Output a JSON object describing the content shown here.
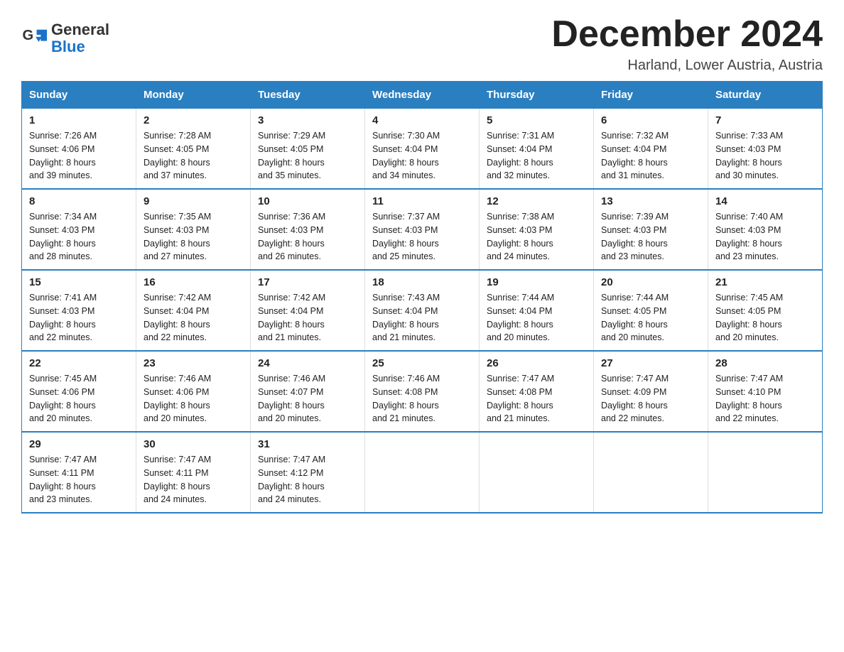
{
  "header": {
    "logo_text_general": "General",
    "logo_text_blue": "Blue",
    "month_title": "December 2024",
    "location": "Harland, Lower Austria, Austria"
  },
  "weekdays": [
    "Sunday",
    "Monday",
    "Tuesday",
    "Wednesday",
    "Thursday",
    "Friday",
    "Saturday"
  ],
  "weeks": [
    [
      {
        "day": "1",
        "sunrise": "7:26 AM",
        "sunset": "4:06 PM",
        "daylight": "8 hours and 39 minutes."
      },
      {
        "day": "2",
        "sunrise": "7:28 AM",
        "sunset": "4:05 PM",
        "daylight": "8 hours and 37 minutes."
      },
      {
        "day": "3",
        "sunrise": "7:29 AM",
        "sunset": "4:05 PM",
        "daylight": "8 hours and 35 minutes."
      },
      {
        "day": "4",
        "sunrise": "7:30 AM",
        "sunset": "4:04 PM",
        "daylight": "8 hours and 34 minutes."
      },
      {
        "day": "5",
        "sunrise": "7:31 AM",
        "sunset": "4:04 PM",
        "daylight": "8 hours and 32 minutes."
      },
      {
        "day": "6",
        "sunrise": "7:32 AM",
        "sunset": "4:04 PM",
        "daylight": "8 hours and 31 minutes."
      },
      {
        "day": "7",
        "sunrise": "7:33 AM",
        "sunset": "4:03 PM",
        "daylight": "8 hours and 30 minutes."
      }
    ],
    [
      {
        "day": "8",
        "sunrise": "7:34 AM",
        "sunset": "4:03 PM",
        "daylight": "8 hours and 28 minutes."
      },
      {
        "day": "9",
        "sunrise": "7:35 AM",
        "sunset": "4:03 PM",
        "daylight": "8 hours and 27 minutes."
      },
      {
        "day": "10",
        "sunrise": "7:36 AM",
        "sunset": "4:03 PM",
        "daylight": "8 hours and 26 minutes."
      },
      {
        "day": "11",
        "sunrise": "7:37 AM",
        "sunset": "4:03 PM",
        "daylight": "8 hours and 25 minutes."
      },
      {
        "day": "12",
        "sunrise": "7:38 AM",
        "sunset": "4:03 PM",
        "daylight": "8 hours and 24 minutes."
      },
      {
        "day": "13",
        "sunrise": "7:39 AM",
        "sunset": "4:03 PM",
        "daylight": "8 hours and 23 minutes."
      },
      {
        "day": "14",
        "sunrise": "7:40 AM",
        "sunset": "4:03 PM",
        "daylight": "8 hours and 23 minutes."
      }
    ],
    [
      {
        "day": "15",
        "sunrise": "7:41 AM",
        "sunset": "4:03 PM",
        "daylight": "8 hours and 22 minutes."
      },
      {
        "day": "16",
        "sunrise": "7:42 AM",
        "sunset": "4:04 PM",
        "daylight": "8 hours and 22 minutes."
      },
      {
        "day": "17",
        "sunrise": "7:42 AM",
        "sunset": "4:04 PM",
        "daylight": "8 hours and 21 minutes."
      },
      {
        "day": "18",
        "sunrise": "7:43 AM",
        "sunset": "4:04 PM",
        "daylight": "8 hours and 21 minutes."
      },
      {
        "day": "19",
        "sunrise": "7:44 AM",
        "sunset": "4:04 PM",
        "daylight": "8 hours and 20 minutes."
      },
      {
        "day": "20",
        "sunrise": "7:44 AM",
        "sunset": "4:05 PM",
        "daylight": "8 hours and 20 minutes."
      },
      {
        "day": "21",
        "sunrise": "7:45 AM",
        "sunset": "4:05 PM",
        "daylight": "8 hours and 20 minutes."
      }
    ],
    [
      {
        "day": "22",
        "sunrise": "7:45 AM",
        "sunset": "4:06 PM",
        "daylight": "8 hours and 20 minutes."
      },
      {
        "day": "23",
        "sunrise": "7:46 AM",
        "sunset": "4:06 PM",
        "daylight": "8 hours and 20 minutes."
      },
      {
        "day": "24",
        "sunrise": "7:46 AM",
        "sunset": "4:07 PM",
        "daylight": "8 hours and 20 minutes."
      },
      {
        "day": "25",
        "sunrise": "7:46 AM",
        "sunset": "4:08 PM",
        "daylight": "8 hours and 21 minutes."
      },
      {
        "day": "26",
        "sunrise": "7:47 AM",
        "sunset": "4:08 PM",
        "daylight": "8 hours and 21 minutes."
      },
      {
        "day": "27",
        "sunrise": "7:47 AM",
        "sunset": "4:09 PM",
        "daylight": "8 hours and 22 minutes."
      },
      {
        "day": "28",
        "sunrise": "7:47 AM",
        "sunset": "4:10 PM",
        "daylight": "8 hours and 22 minutes."
      }
    ],
    [
      {
        "day": "29",
        "sunrise": "7:47 AM",
        "sunset": "4:11 PM",
        "daylight": "8 hours and 23 minutes."
      },
      {
        "day": "30",
        "sunrise": "7:47 AM",
        "sunset": "4:11 PM",
        "daylight": "8 hours and 24 minutes."
      },
      {
        "day": "31",
        "sunrise": "7:47 AM",
        "sunset": "4:12 PM",
        "daylight": "8 hours and 24 minutes."
      },
      null,
      null,
      null,
      null
    ]
  ],
  "labels": {
    "sunrise": "Sunrise:",
    "sunset": "Sunset:",
    "daylight": "Daylight:"
  }
}
